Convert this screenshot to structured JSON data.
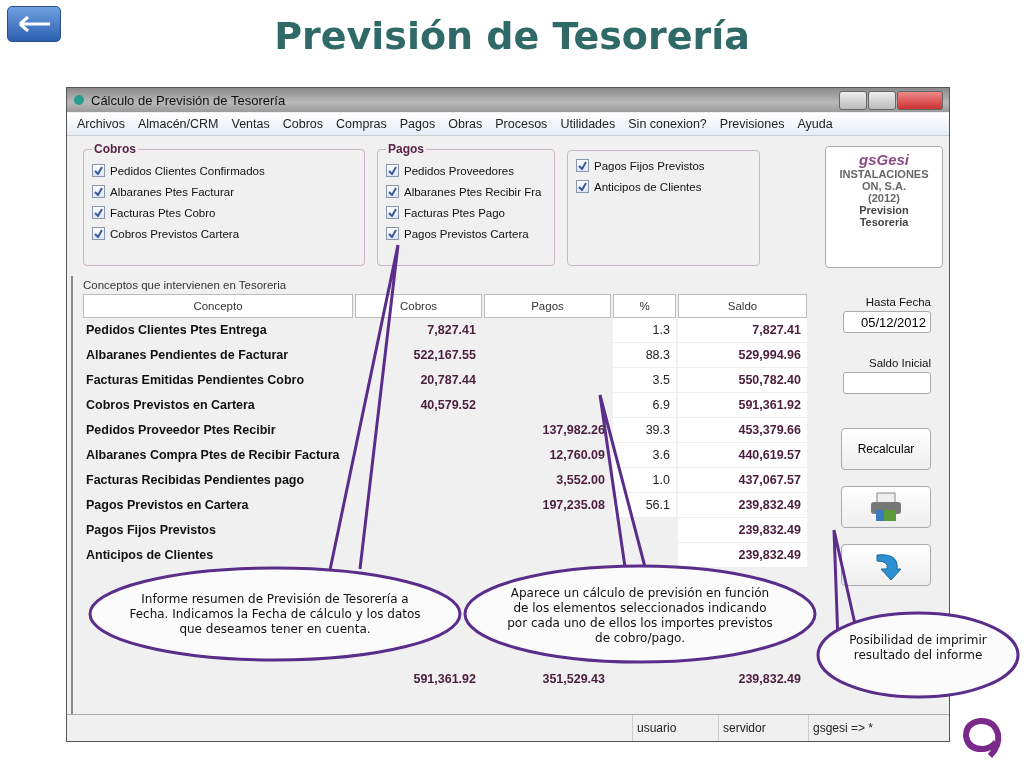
{
  "slide": {
    "title": "Previsión de Tesorería"
  },
  "window": {
    "title": "Cálculo de Previsión de Tesorería"
  },
  "menu": [
    "Archivos",
    "Almacén/CRM",
    "Ventas",
    "Cobros",
    "Compras",
    "Pagos",
    "Obras",
    "Procesos",
    "Utilidades",
    "Sin conexion?",
    "Previsiones",
    "Ayuda"
  ],
  "groups": [
    {
      "title": "Cobros",
      "items": [
        {
          "label": "Pedidos Clientes Confirmados",
          "checked": true
        },
        {
          "label": "Albaranes Ptes Facturar",
          "checked": true
        },
        {
          "label": "Facturas Ptes Cobro",
          "checked": true
        },
        {
          "label": "Cobros Previstos Cartera",
          "checked": true
        }
      ]
    },
    {
      "title": "Pagos",
      "items": [
        {
          "label": "Pedidos Proveedores",
          "checked": true
        },
        {
          "label": "Albaranes Ptes Recibir Fra",
          "checked": true
        },
        {
          "label": "Facturas Ptes Pago",
          "checked": true
        },
        {
          "label": "Pagos Previstos Cartera",
          "checked": true
        }
      ]
    },
    {
      "items": [
        {
          "label": "Pagos Fijos Previstos",
          "checked": true
        },
        {
          "label": "Anticipos de Clientes",
          "checked": true
        }
      ]
    }
  ],
  "logo_panel": {
    "brand": "gsGesi",
    "lines": [
      "INSTALACIONES",
      "ON, S.A.",
      "(2012)"
    ],
    "caption": "Prevision Tesoreria"
  },
  "table": {
    "title": "Conceptos que intervienen en Tesoreria",
    "columns": [
      "Concepto",
      "Cobros",
      "Pagos",
      "%",
      "Saldo"
    ],
    "rows": [
      {
        "concepto": "Pedidos Clientes Ptes Entrega",
        "cobros": "7,827.41",
        "pct": "1.3",
        "saldo": "7,827.41"
      },
      {
        "concepto": "Albaranes Pendientes de Facturar",
        "cobros": "522,167.55",
        "pct": "88.3",
        "saldo": "529,994.96"
      },
      {
        "concepto": "Facturas Emitidas Pendientes Cobro",
        "cobros": "20,787.44",
        "pct": "3.5",
        "saldo": "550,782.40"
      },
      {
        "concepto": "Cobros Previstos en Cartera",
        "cobros": "40,579.52",
        "pct": "6.9",
        "saldo": "591,361.92"
      },
      {
        "concepto": "Pedidos Proveedor Ptes Recibir",
        "pagos": "137,982.26",
        "pct": "39.3",
        "saldo": "453,379.66"
      },
      {
        "concepto": "Albaranes Compra Ptes de Recibir Factura",
        "pagos": "12,760.09",
        "pct": "3.6",
        "saldo": "440,619.57"
      },
      {
        "concepto": "Facturas Recibidas Pendientes pago",
        "pagos": "3,552.00",
        "pct": "1.0",
        "saldo": "437,067.57"
      },
      {
        "concepto": "Pagos Previstos en Cartera",
        "pagos": "197,235.08",
        "pct": "56.1",
        "saldo": "239,832.49"
      },
      {
        "concepto": "Pagos Fijos Previstos",
        "saldo": "239,832.49"
      },
      {
        "concepto": "Anticipos de Clientes",
        "saldo": "239,832.49"
      }
    ],
    "totals": {
      "cobros": "591,361.92",
      "pagos": "351,529.43",
      "saldo": "239,832.49"
    }
  },
  "side_panel": {
    "date_label": "Hasta Fecha",
    "date_value": "05/12/2012",
    "balance_label": "Saldo Inicial",
    "recalc_button": "Recalcular"
  },
  "status_bar": [
    "usuario",
    "servidor",
    "gsgesi => *"
  ],
  "callouts": [
    "Informe resumen de Previsión de Tesorería a Fecha. Indicamos la Fecha de cálculo y los datos que deseamos tener en cuenta.",
    "Aparece un cálculo de previsión en función de los elementos seleccionados indicando por cada uno de ellos los importes previstos de cobro/pago.",
    "Posibilidad de imprimir resultado del informe"
  ]
}
